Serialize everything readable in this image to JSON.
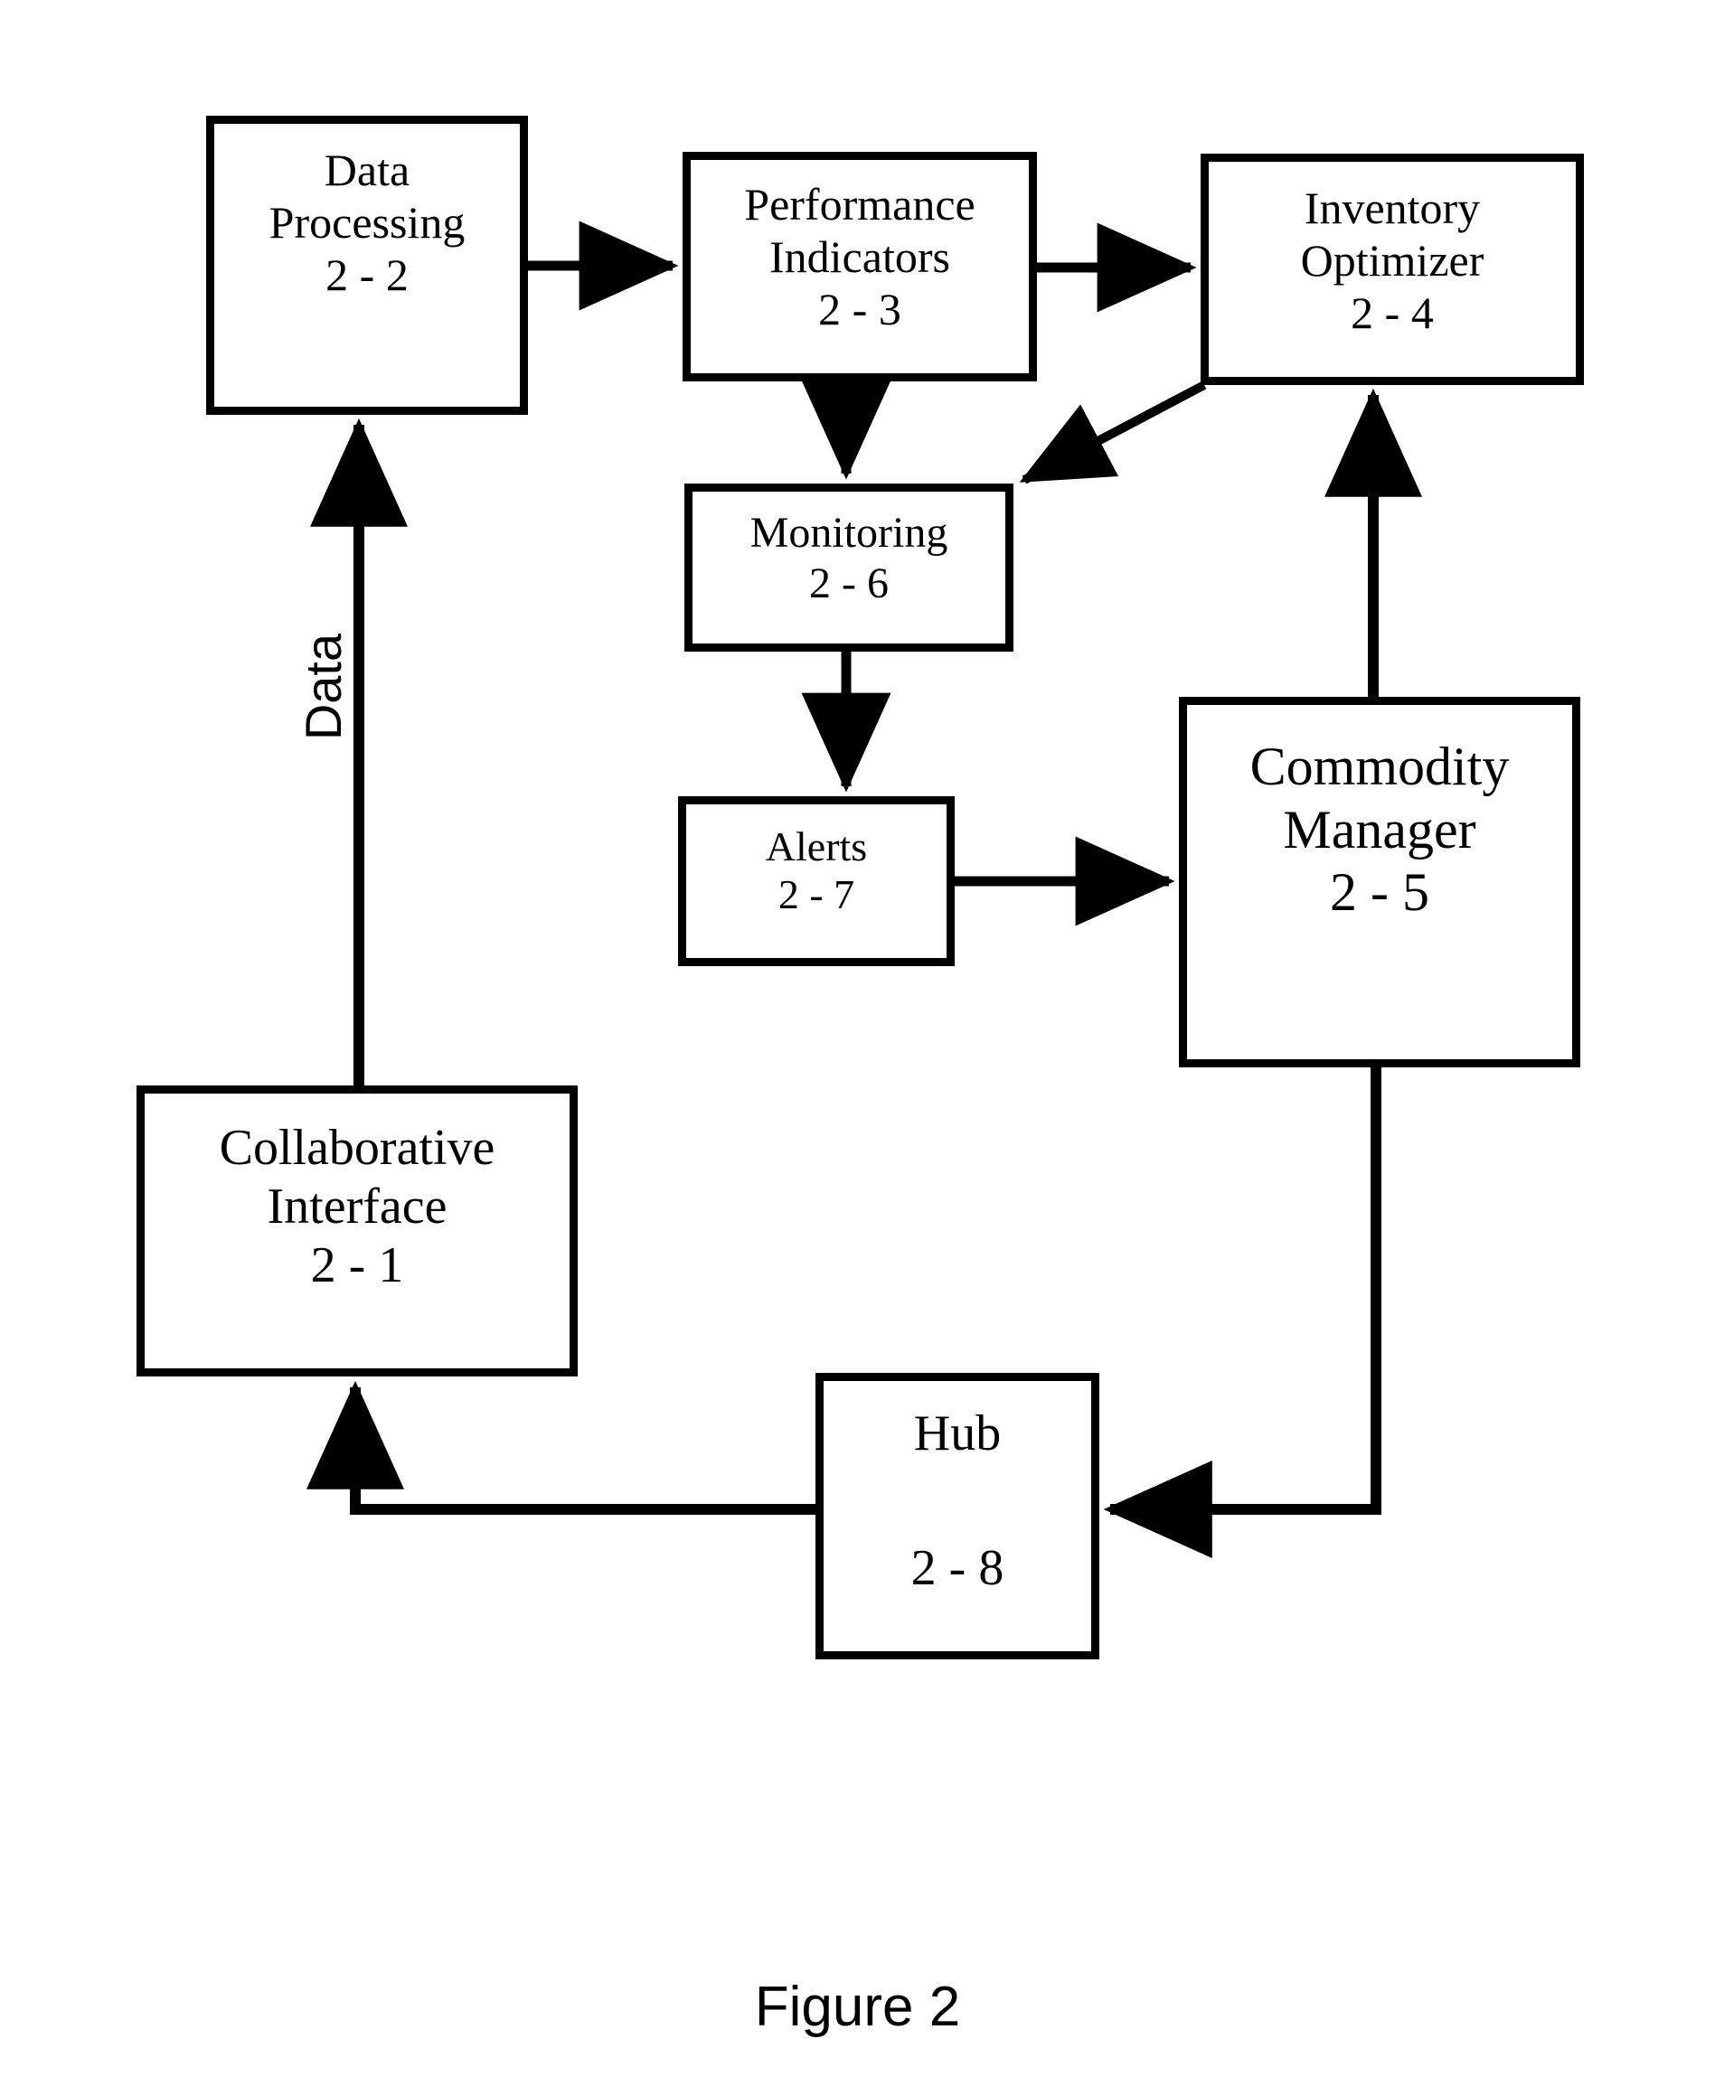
{
  "figure": {
    "caption": "Figure 2"
  },
  "diagram": {
    "type": "flow-diagram",
    "nodes": [
      {
        "id": "data-processing",
        "label": "Data\nProcessing",
        "ref": "2 - 2"
      },
      {
        "id": "performance-indicators",
        "label": "Performance\nIndicators",
        "ref": "2 - 3"
      },
      {
        "id": "inventory-optimizer",
        "label": "Inventory\nOptimizer",
        "ref": "2 - 4"
      },
      {
        "id": "monitoring",
        "label": "Monitoring",
        "ref": "2 - 6"
      },
      {
        "id": "alerts",
        "label": "Alerts",
        "ref": "2 - 7"
      },
      {
        "id": "commodity-manager",
        "label": "Commodity\nManager",
        "ref": "2 - 5"
      },
      {
        "id": "collaborative-interface",
        "label": "Collaborative\nInterface",
        "ref": "2 - 1"
      },
      {
        "id": "hub",
        "label": "Hub",
        "ref": "2 - 8"
      }
    ],
    "edges": [
      {
        "from": "data-processing",
        "to": "performance-indicators",
        "label": ""
      },
      {
        "from": "performance-indicators",
        "to": "inventory-optimizer",
        "label": ""
      },
      {
        "from": "performance-indicators",
        "to": "monitoring",
        "label": ""
      },
      {
        "from": "inventory-optimizer",
        "to": "monitoring",
        "label": ""
      },
      {
        "from": "monitoring",
        "to": "alerts",
        "label": ""
      },
      {
        "from": "alerts",
        "to": "commodity-manager",
        "label": ""
      },
      {
        "from": "commodity-manager",
        "to": "inventory-optimizer",
        "label": ""
      },
      {
        "from": "commodity-manager",
        "to": "hub",
        "label": ""
      },
      {
        "from": "hub",
        "to": "collaborative-interface",
        "label": ""
      },
      {
        "from": "collaborative-interface",
        "to": "data-processing",
        "label": "Data"
      }
    ],
    "edge_label_data": "Data",
    "colors": {
      "stroke": "#000000",
      "fill": "#ffffff",
      "text": "#000000"
    }
  }
}
